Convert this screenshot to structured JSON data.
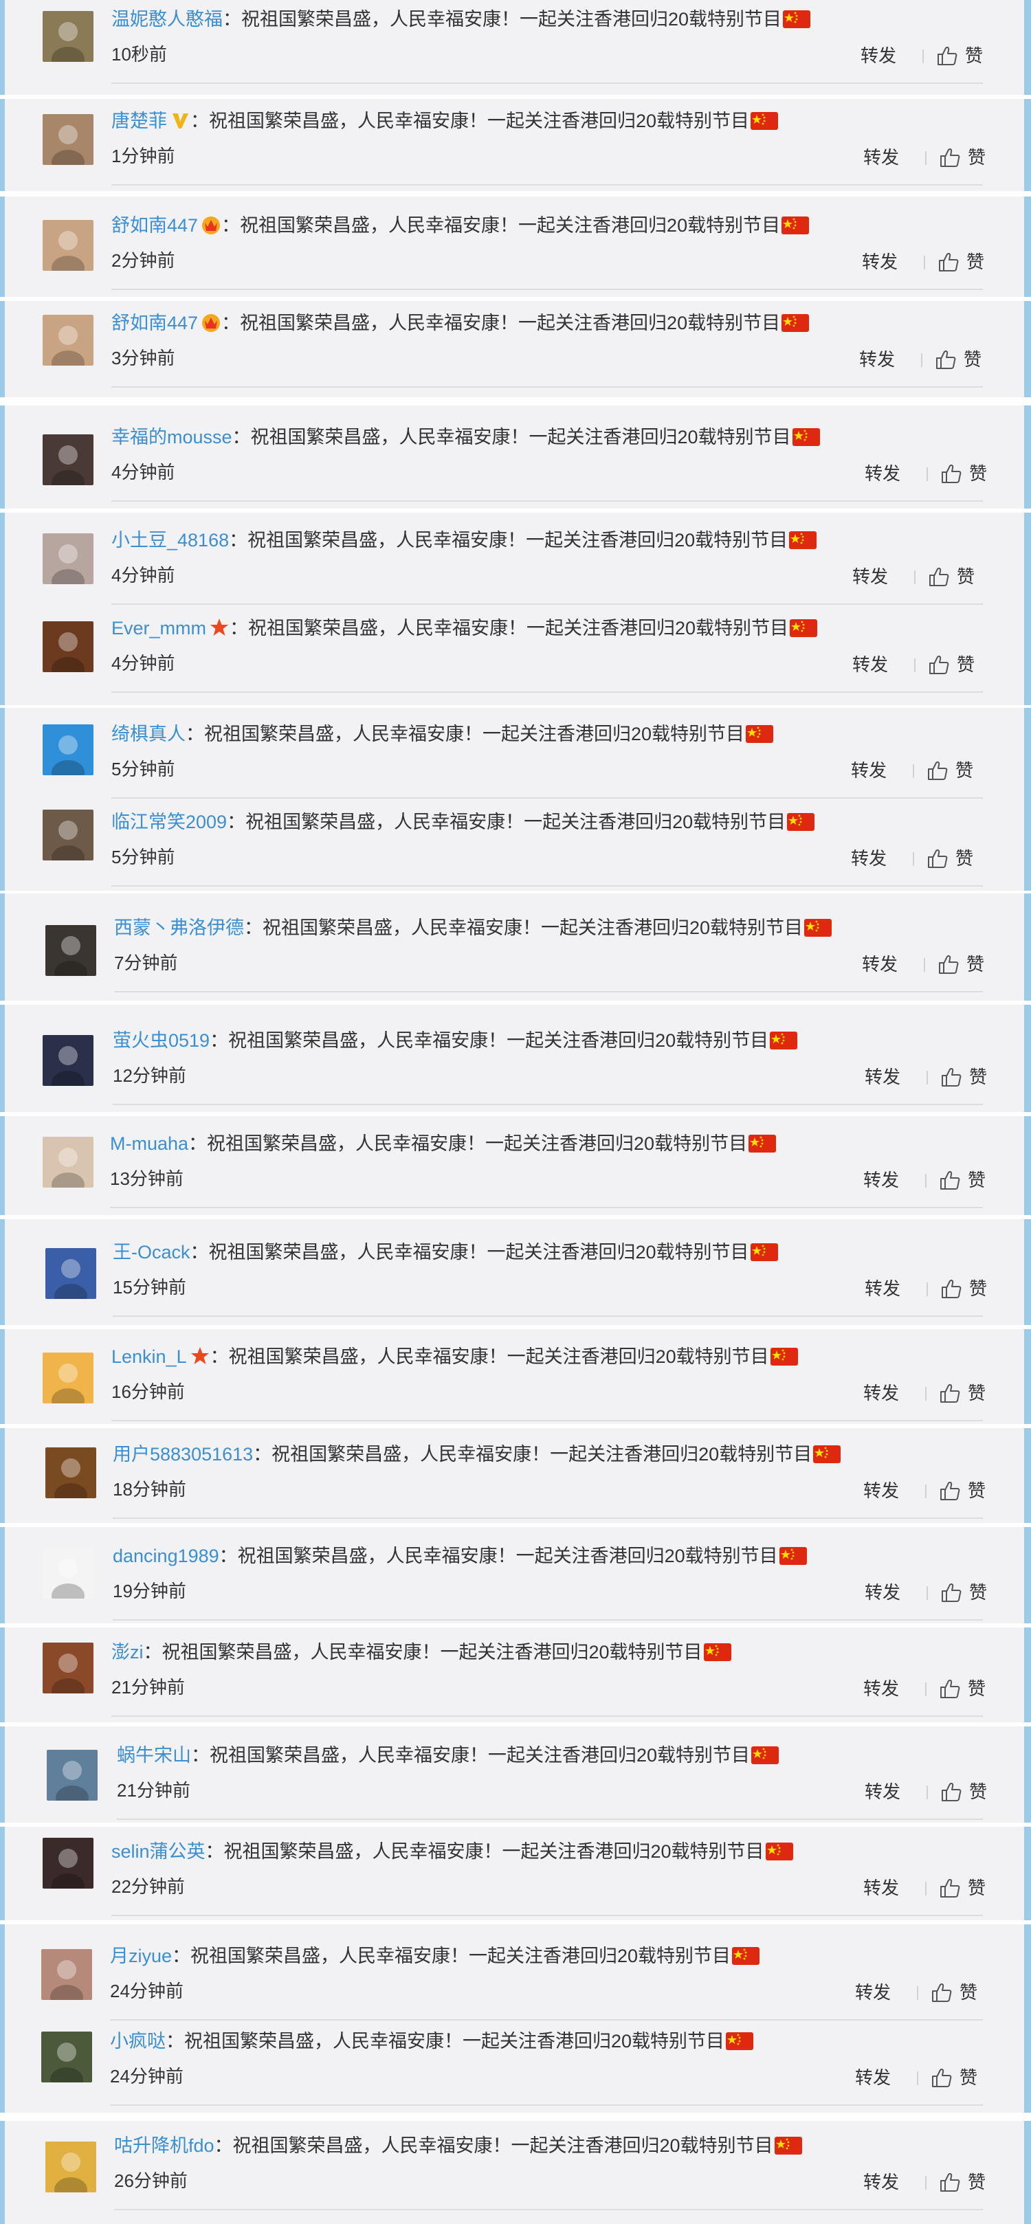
{
  "comment_text": "祝祖国繁荣昌盛，人民幸福安康！一起关注香港回归20载特别节目",
  "actions": {
    "repost": "转发",
    "like": "赞"
  },
  "colors": {
    "username": "#3b8fd1",
    "panel_bg": "#f2f2f5",
    "accent_bar": "#9ccbe9",
    "flag_red": "#de2910",
    "flag_star": "#ffde00"
  },
  "comments": [
    {
      "user": "温妮憨人憨福",
      "time": "10秒前",
      "badge": "",
      "avatar_color": "#8a7a55"
    },
    {
      "user": "唐楚菲",
      "time": "1分钟前",
      "badge": "v-icon",
      "avatar_color": "#a8866a"
    },
    {
      "user": "舒如南447",
      "time": "2分钟前",
      "badge": "crown-icon",
      "avatar_color": "#c9a483"
    },
    {
      "user": "舒如南447",
      "time": "3分钟前",
      "badge": "crown-icon",
      "avatar_color": "#c9a483"
    },
    {
      "user": "幸福的mousse",
      "time": "4分钟前",
      "badge": "",
      "avatar_color": "#4a3a35"
    },
    {
      "user": "小土豆_48168",
      "time": "4分钟前",
      "badge": "",
      "avatar_color": "#b7a6a0"
    },
    {
      "user": "Ever_mmm",
      "time": "4分钟前",
      "badge": "star-icon",
      "avatar_color": "#6b3a1f"
    },
    {
      "user": "绮椇真人",
      "time": "5分钟前",
      "badge": "",
      "avatar_color": "#2f8fd8"
    },
    {
      "user": "临江常笑2009",
      "time": "5分钟前",
      "badge": "",
      "avatar_color": "#6d5a48"
    },
    {
      "user": "西蒙丶弗洛伊德",
      "time": "7分钟前",
      "badge": "",
      "avatar_color": "#3a3530"
    },
    {
      "user": "萤火虫0519",
      "time": "12分钟前",
      "badge": "",
      "avatar_color": "#2a2f4a"
    },
    {
      "user": "M-muaha",
      "time": "13分钟前",
      "badge": "",
      "avatar_color": "#d9c4b0"
    },
    {
      "user": "王-Ocack",
      "time": "15分钟前",
      "badge": "",
      "avatar_color": "#3a5fa8"
    },
    {
      "user": "Lenkin_L",
      "time": "16分钟前",
      "badge": "star-icon",
      "avatar_color": "#f0b44a"
    },
    {
      "user": "用户5883051613",
      "time": "18分钟前",
      "badge": "",
      "avatar_color": "#7a4a20"
    },
    {
      "user": "dancing1989",
      "time": "19分钟前",
      "badge": "",
      "avatar_color": "#f4f4f4"
    },
    {
      "user": "澎zi",
      "time": "21分钟前",
      "badge": "",
      "avatar_color": "#8a4a2a"
    },
    {
      "user": "蜗牛宋山",
      "time": "21分钟前",
      "badge": "",
      "avatar_color": "#5f7f9a"
    },
    {
      "user": "selin蒲公英",
      "time": "22分钟前",
      "badge": "",
      "avatar_color": "#3a2a2a"
    },
    {
      "user": "月ziyue",
      "time": "24分钟前",
      "badge": "",
      "avatar_color": "#b58a7a"
    },
    {
      "user": "小疯哒",
      "time": "24分钟前",
      "badge": "",
      "avatar_color": "#4a5a3a"
    },
    {
      "user": "咕升降机fdo",
      "time": "26分钟前",
      "badge": "",
      "avatar_color": "#e0b040"
    }
  ]
}
